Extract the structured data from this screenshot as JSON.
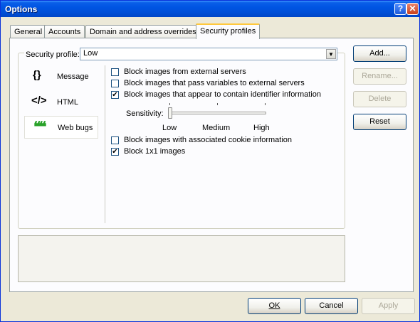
{
  "window": {
    "title": "Options"
  },
  "tabs": [
    "General",
    "Accounts",
    "Domain and address overrides",
    "Security profiles"
  ],
  "profile": {
    "label": "Security profile:",
    "value": "Low"
  },
  "categories": [
    {
      "icon": "{}",
      "label": "Message"
    },
    {
      "icon": "</>",
      "label": "HTML"
    },
    {
      "icon": "❝❝",
      "label": "Web bugs"
    }
  ],
  "options": [
    {
      "label": "Block images from external servers",
      "checked": false
    },
    {
      "label": "Block images that pass variables to external servers",
      "checked": false
    },
    {
      "label": "Block images that appear to contain identifier information",
      "checked": true
    },
    {
      "label": "Block images with associated cookie information",
      "checked": false
    },
    {
      "label": "Block 1x1 images",
      "checked": true
    }
  ],
  "sensitivity": {
    "label": "Sensitivity:",
    "low": "Low",
    "medium": "Medium",
    "high": "High",
    "level": 0
  },
  "side_buttons": {
    "add": "Add...",
    "rename": "Rename...",
    "delete": "Delete",
    "reset": "Reset"
  },
  "footer_buttons": {
    "ok": "OK",
    "cancel": "Cancel",
    "apply": "Apply"
  },
  "checkmark": "✔",
  "colors": {
    "titlebar": "#0054e3",
    "tab_highlight": "#ffc83c",
    "face": "#ece9d8"
  }
}
